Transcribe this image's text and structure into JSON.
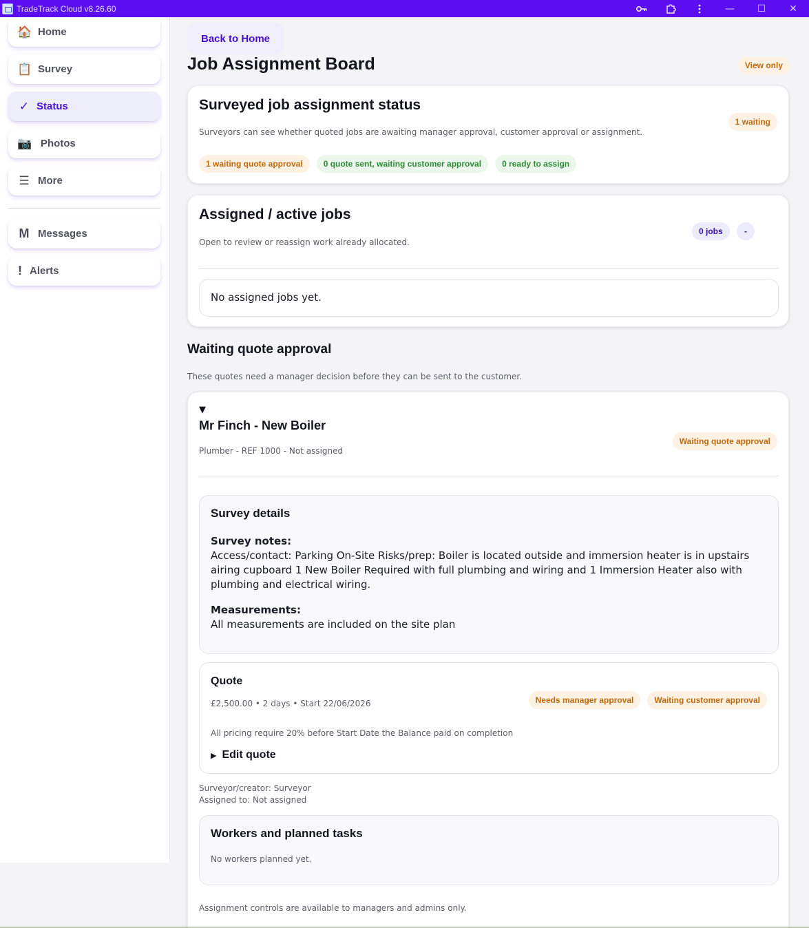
{
  "window": {
    "title": "TradeTrack Cloud v8.26.60",
    "controls": {
      "minimize": "—",
      "maximize": "☐",
      "close": "✕"
    }
  },
  "sidebar": {
    "items": [
      {
        "label": "Home",
        "icon": "house-icon",
        "glyph": "🏠"
      },
      {
        "label": "Survey",
        "icon": "clipboard-icon",
        "glyph": "📋"
      },
      {
        "label": "Status",
        "icon": "checkmark-icon",
        "glyph": "✓"
      },
      {
        "label": "Photos",
        "icon": "camera-icon",
        "glyph": "📷"
      },
      {
        "label": "More",
        "icon": "menu-icon",
        "glyph": "☰"
      }
    ],
    "secondary": [
      {
        "label": "Messages",
        "icon": "messages-icon",
        "glyph": "M"
      },
      {
        "label": "Alerts",
        "icon": "alert-icon",
        "glyph": "!"
      }
    ],
    "active": "Status"
  },
  "header": {
    "back_label": "Back to Home",
    "title": "Job Assignment Board",
    "mode_badge": "View only"
  },
  "status_card": {
    "title": "Surveyed job assignment status",
    "description": "Surveyors can see whether quoted jobs are awaiting manager approval, customer approval or assignment.",
    "badge": "1 waiting",
    "pills": [
      "1 waiting quote approval",
      "0 quote sent, waiting customer approval",
      "0 ready to assign"
    ]
  },
  "active_card": {
    "title": "Assigned / active jobs",
    "description": "Open to review or reassign work already allocated.",
    "count_badge": "0 jobs",
    "toggle_badge": "-",
    "empty_text": "No assigned jobs yet."
  },
  "waiting_section": {
    "title": "Waiting quote approval",
    "description": "These quotes need a manager decision before they can be sent to the customer."
  },
  "job": {
    "toggle": "▼",
    "title": "Mr Finch - New Boiler",
    "meta": "Plumber - REF 1000 - Not assigned",
    "status": "Waiting quote approval",
    "survey": {
      "heading": "Survey details",
      "notes_label": "Survey notes:",
      "notes": "Access/contact: Parking On-Site Risks/prep: Boiler is located outside and immersion heater is in upstairs airing cupboard 1 New Boiler Required with full plumbing and wiring and 1 Immersion Heater also with plumbing and electrical wiring.",
      "measurements_label": "Measurements:",
      "measurements": "All measurements are included on the site plan"
    },
    "quote": {
      "heading": "Quote",
      "summary": "£2,500.00 • 2 days • Start 22/06/2026",
      "badges": [
        "Needs manager approval",
        "Waiting customer approval"
      ],
      "terms": "All pricing require 20% before Start Date the Balance paid on completion",
      "edit_toggle": "▶",
      "edit_label": "Edit quote"
    },
    "surveyor_line": "Surveyor/creator: Surveyor",
    "assigned_line": "Assigned to: Not assigned",
    "workers": {
      "heading": "Workers and planned tasks",
      "empty": "No workers planned yet."
    },
    "footer_note": "Assignment controls are available to managers and admins only."
  },
  "colors": {
    "titlebar": "#5b0ff0",
    "accent": "#4b12d6",
    "orange_text": "#c06a0c",
    "green_text": "#2f8a3a"
  }
}
